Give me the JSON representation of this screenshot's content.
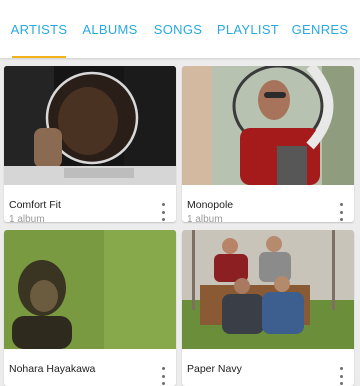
{
  "tabs": [
    {
      "label": "ARTISTS",
      "active": true
    },
    {
      "label": "ALBUMS",
      "active": false
    },
    {
      "label": "SONGS",
      "active": false
    },
    {
      "label": "PLAYLIST",
      "active": false
    },
    {
      "label": "GENRES",
      "active": false
    }
  ],
  "colors": {
    "accent": "#29a9df",
    "indicator": "#f2b31b"
  },
  "artists": [
    {
      "name": "Comfort Fit",
      "count": "1 album",
      "menu_icon": "more-vert-icon"
    },
    {
      "name": "Monopole",
      "count": "1 album",
      "menu_icon": "more-vert-icon"
    },
    {
      "name": "Nohara Hayakawa",
      "count": "",
      "menu_icon": "more-vert-icon"
    },
    {
      "name": "Paper Navy",
      "count": "",
      "menu_icon": "more-vert-icon"
    }
  ]
}
